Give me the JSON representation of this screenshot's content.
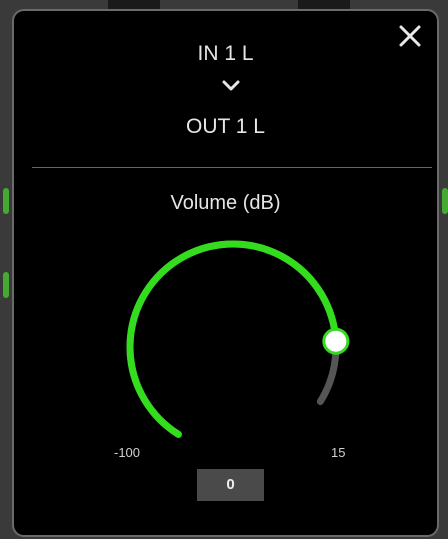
{
  "routing": {
    "input_label": "IN 1 L",
    "arrow_icon": "chevron-down-icon",
    "output_label": "OUT 1 L"
  },
  "close_icon": "close-icon",
  "volume": {
    "label": "Volume (dB)",
    "min_label": "-100",
    "max_label": "15",
    "min": -100,
    "max": 15,
    "value": 0,
    "value_display": "0"
  },
  "colors": {
    "accent": "#33dd1e",
    "track": "#555555",
    "panel_bg": "#000000",
    "text": "#e6e6e6",
    "value_box": "#4a4a4a"
  }
}
